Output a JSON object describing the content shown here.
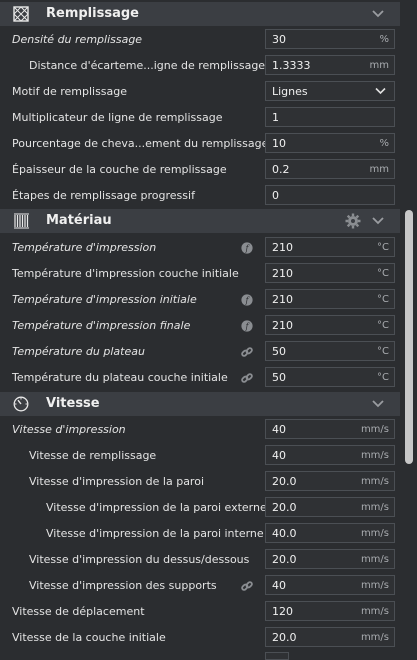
{
  "infill": {
    "title": "Remplissage",
    "rows": [
      {
        "label": "Densité du remplissage",
        "value": "30",
        "unit": "%"
      },
      {
        "label": "Distance d'écarteme...igne de remplissage",
        "value": "1.3333",
        "unit": "mm"
      },
      {
        "label": "Motif de remplissage",
        "value": "Lignes",
        "unit": ""
      },
      {
        "label": "Multiplicateur de ligne de remplissage",
        "value": "1",
        "unit": ""
      },
      {
        "label": "Pourcentage de cheva...ement du remplissage",
        "value": "10",
        "unit": "%"
      },
      {
        "label": "Épaisseur de la couche de remplissage",
        "value": "0.2",
        "unit": "mm"
      },
      {
        "label": "Étapes de remplissage progressif",
        "value": "0",
        "unit": ""
      }
    ]
  },
  "material": {
    "title": "Matériau",
    "rows": [
      {
        "label": "Température d'impression",
        "value": "210",
        "unit": "°C"
      },
      {
        "label": "Température d'impression couche initiale",
        "value": "210",
        "unit": "°C"
      },
      {
        "label": "Température d'impression initiale",
        "value": "210",
        "unit": "°C"
      },
      {
        "label": "Température d'impression finale",
        "value": "210",
        "unit": "°C"
      },
      {
        "label": "Température du plateau",
        "value": "50",
        "unit": "°C"
      },
      {
        "label": "Température du plateau couche initiale",
        "value": "50",
        "unit": "°C"
      }
    ]
  },
  "speed": {
    "title": "Vitesse",
    "rows": [
      {
        "label": "Vitesse d'impression",
        "value": "40",
        "unit": "mm/s"
      },
      {
        "label": "Vitesse de remplissage",
        "value": "40",
        "unit": "mm/s"
      },
      {
        "label": "Vitesse d'impression de la paroi",
        "value": "20.0",
        "unit": "mm/s"
      },
      {
        "label": "Vitesse d'impression de la paroi externe",
        "value": "20.0",
        "unit": "mm/s"
      },
      {
        "label": "Vitesse d'impression de la paroi interne",
        "value": "40.0",
        "unit": "mm/s"
      },
      {
        "label": "Vitesse d'impression du dessus/dessous",
        "value": "20.0",
        "unit": "mm/s"
      },
      {
        "label": "Vitesse d'impression des supports",
        "value": "40",
        "unit": "mm/s"
      },
      {
        "label": "Vitesse de déplacement",
        "value": "120",
        "unit": "mm/s"
      },
      {
        "label": "Vitesse de la couche initiale",
        "value": "20.0",
        "unit": "mm/s"
      }
    ]
  }
}
